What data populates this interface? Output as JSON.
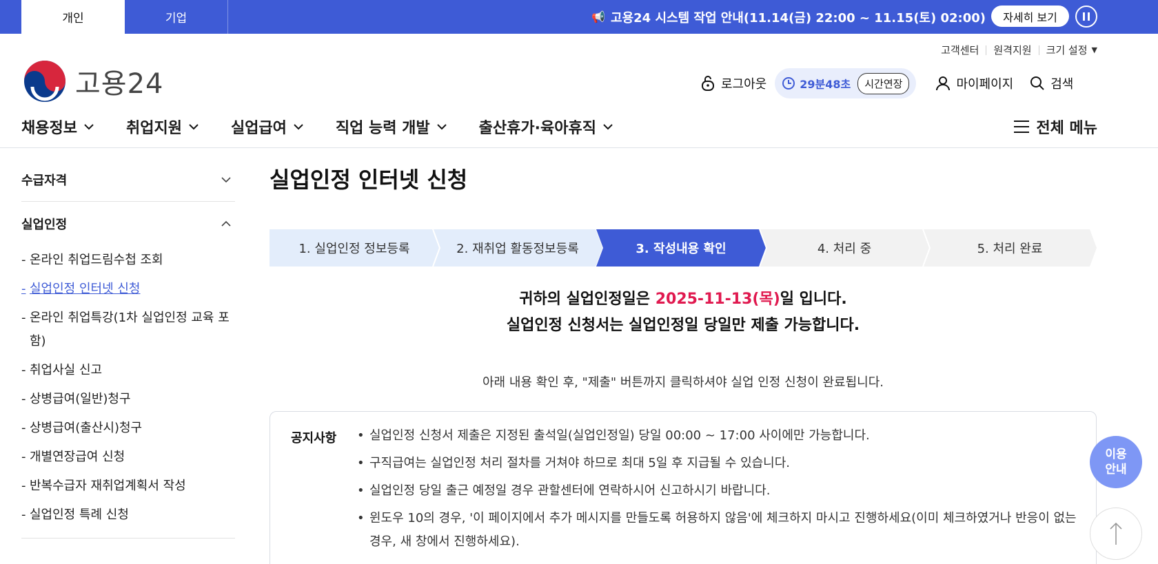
{
  "topbar": {
    "tabs": [
      "개인",
      "기업"
    ],
    "notice": "고용24 시스템 작업 안내(11.14(금) 22:00 ~ 11.15(토) 02:00)",
    "detail_button": "자세히 보기"
  },
  "util_links": [
    "고객센터",
    "원격지원",
    "크기 설정"
  ],
  "logo": {
    "text": "고용24"
  },
  "header": {
    "logout": "로그아웃",
    "timer": "29분48초",
    "extend": "시간연장",
    "mypage": "마이페이지",
    "search": "검색"
  },
  "gnb": {
    "menus": [
      "채용정보",
      "취업지원",
      "실업급여",
      "직업 능력 개발",
      "출산휴가·육아휴직"
    ],
    "all_menu": "전체 메뉴"
  },
  "sidebar": {
    "groups": [
      {
        "title": "수급자격",
        "expanded": false
      },
      {
        "title": "실업인정",
        "expanded": true,
        "items": [
          {
            "label": "온라인 취업드림수첩 조회",
            "active": false
          },
          {
            "label": "실업인정 인터넷 신청",
            "active": true
          },
          {
            "label": "온라인 취업특강(1차 실업인정 교육 포함)",
            "active": false
          },
          {
            "label": "취업사실 신고",
            "active": false
          },
          {
            "label": "상병급여(일반)청구",
            "active": false
          },
          {
            "label": "상병급여(출산시)청구",
            "active": false
          },
          {
            "label": "개별연장급여 신청",
            "active": false
          },
          {
            "label": "반복수급자 재취업계획서 작성",
            "active": false
          },
          {
            "label": "실업인정 특례 신청",
            "active": false
          }
        ]
      }
    ]
  },
  "main": {
    "title": "실업인정 인터넷 신청",
    "steps": [
      {
        "label": "1. 실업인정 정보등록",
        "state": "done"
      },
      {
        "label": "2. 재취업 활동정보등록",
        "state": "done"
      },
      {
        "label": "3. 작성내용 확인",
        "state": "current"
      },
      {
        "label": "4. 처리 중",
        "state": "todo"
      },
      {
        "label": "5. 처리 완료",
        "state": "todo"
      }
    ],
    "headline_prefix": "귀하의 실업인정일은 ",
    "headline_date": "2025-11-13(목)",
    "headline_suffix": "일 입니다.",
    "headline_line2": "실업인정 신청서는 실업인정일 당일만 제출 가능합니다.",
    "sub_note": "아래 내용 확인 후, \"제출\" 버튼까지 클릭하셔야 실업 인정 신청이 완료됩니다.",
    "notice_label": "공지사항",
    "notices": [
      "실업인정 신청서 제출은 지정된 출석일(실업인정일) 당일 00:00 ~ 17:00 사이에만 가능합니다.",
      "구직급여는 실업인정 처리 절차를 거쳐야 하므로 최대 5일 후 지급될 수 있습니다.",
      "실업인정 당일 출근 예정일 경우 관할센터에 연락하시어 신고하시기 바랍니다.",
      "윈도우 10의 경우, '이 페이지에서 추가 메시지를 만들도록 허용하지 않음'에 체크하지 마시고 진행하세요(이미 체크하였거나 반응이 없는 경우, 새 창에서 진행하세요)."
    ]
  },
  "floating": {
    "help_line1": "이용",
    "help_line2": "안내"
  },
  "colors": {
    "brand": "#3e5bd6",
    "highlight": "#e0194f",
    "step_done": "#e3edfb",
    "step_todo": "#f2f2f2"
  }
}
